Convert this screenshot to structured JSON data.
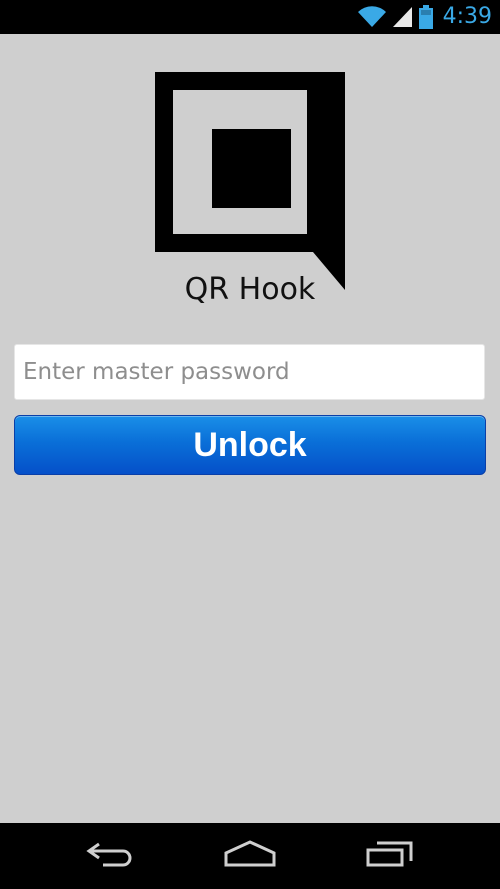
{
  "status_bar": {
    "time": "4:39",
    "icons": [
      "wifi-icon",
      "signal-icon",
      "battery-icon"
    ],
    "accent_color": "#3aa9e6"
  },
  "app": {
    "name": "QR Hook",
    "logo_icon": "qr-hook-logo-icon"
  },
  "form": {
    "password_placeholder": "Enter master password",
    "password_value": "",
    "unlock_label": "Unlock",
    "button_color": "#0a6fd8"
  },
  "nav_bar": {
    "icons": [
      "back-icon",
      "home-icon",
      "recents-icon"
    ]
  }
}
